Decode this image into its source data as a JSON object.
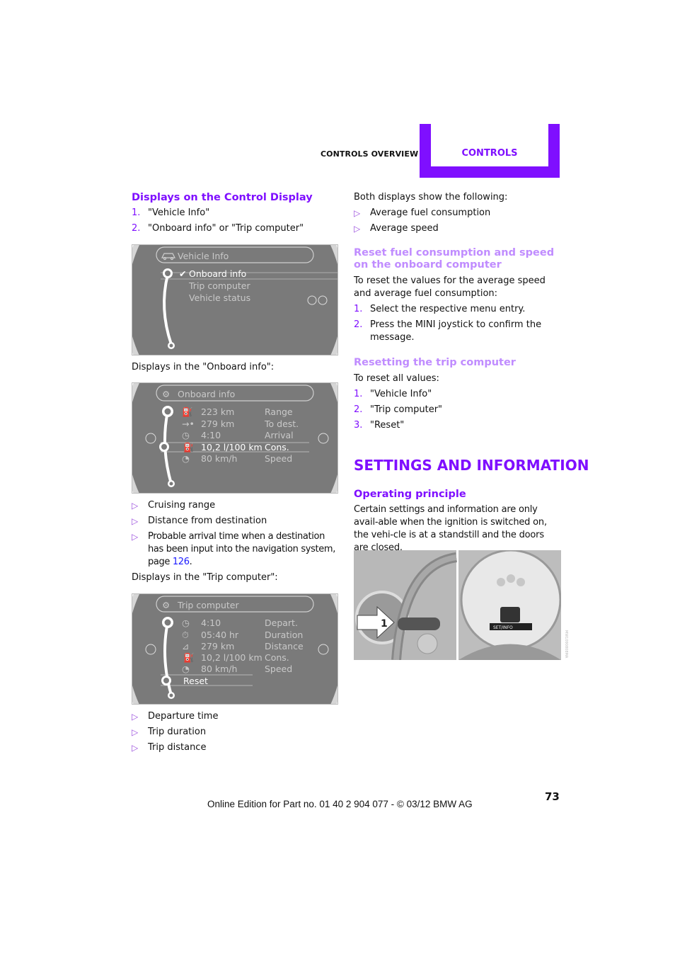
{
  "header": {
    "section": "CONTROLS OVERVIEW",
    "tab": "CONTROLS",
    "accent_color": "#7f0fff"
  },
  "left": {
    "heading": "Displays on the Control Display",
    "steps": [
      {
        "num": "1.",
        "text": "\"Vehicle Info\""
      },
      {
        "num": "2.",
        "text": "\"Onboard info\" or \"Trip computer\""
      }
    ],
    "screen1": {
      "title": "Vehicle Info",
      "items": [
        {
          "label": "Onboard info",
          "checked": true,
          "selected": true
        },
        {
          "label": "Trip computer"
        },
        {
          "label": "Vehicle status"
        }
      ]
    },
    "caption_onboard": "Displays in the \"Onboard info\":",
    "screen2": {
      "title": "Onboard info",
      "rows": [
        {
          "icon": "fuel-pump-range-icon",
          "value": "223 km",
          "label": "Range"
        },
        {
          "icon": "destination-arrow-icon",
          "value": "279 km",
          "label": "To dest."
        },
        {
          "icon": "arrival-clock-icon",
          "value": "4:10",
          "label": "Arrival"
        },
        {
          "icon": "fuel-pump-icon",
          "value": "10,2 l/100 km",
          "label": "Cons.",
          "selected": true
        },
        {
          "icon": "speedometer-icon",
          "value": "80 km/h",
          "label": "Speed"
        }
      ]
    },
    "onboard_bullets": [
      "Cruising range",
      "Distance from destination"
    ],
    "onboard_bullet3_text": "Probable arrival time when a destination has been input into the navigation system, page ",
    "onboard_bullet3_link": "126",
    "onboard_bullet3_end": ".",
    "caption_trip": "Displays in the \"Trip computer\":",
    "screen3": {
      "title": "Trip computer",
      "rows": [
        {
          "icon": "departure-clock-icon",
          "value": "4:10",
          "label": "Depart."
        },
        {
          "icon": "duration-stopwatch-icon",
          "value": "05:40 hr",
          "label": "Duration"
        },
        {
          "icon": "distance-road-icon",
          "value": "279  km",
          "label": "Distance"
        },
        {
          "icon": "fuel-pump-icon",
          "value": "10,2 l/100 km",
          "label": "Cons."
        },
        {
          "icon": "speedometer-icon",
          "value": "80 km/h",
          "label": "Speed"
        }
      ],
      "reset_label": "Reset"
    },
    "trip_bullets": [
      "Departure time",
      "Trip duration",
      "Trip distance"
    ]
  },
  "right": {
    "intro": "Both displays show the following:",
    "both_bullets": [
      "Average fuel consumption",
      "Average speed"
    ],
    "reset_heading": "Reset fuel consumption and speed on the onboard computer",
    "reset_para": "To reset the values for the average speed and average fuel consumption:",
    "reset_steps": [
      {
        "num": "1.",
        "text": "Select the respective menu entry."
      },
      {
        "num": "2.",
        "text": "Press the MINI joystick to confirm the message."
      }
    ],
    "trip_heading": "Resetting the trip computer",
    "trip_para": "To reset all values:",
    "trip_steps": [
      {
        "num": "1.",
        "text": "\"Vehicle Info\""
      },
      {
        "num": "2.",
        "text": "\"Trip computer\""
      },
      {
        "num": "3.",
        "text": "\"Reset\""
      }
    ],
    "section_title": "SETTINGS AND INFORMATION",
    "op_heading": "Operating principle",
    "op_para": "Certain settings and information are only avail-able when the ignition is switched on, the vehi-cle is at a standstill and the doors are closed.",
    "photo": {
      "callout": "1",
      "display_text": "SET/INFO",
      "image_code": "MW1090808MA"
    }
  },
  "footer": {
    "text": "Online Edition for Part no. 01 40 2 904 077 - © 03/12 BMW AG",
    "page_number": "73"
  }
}
